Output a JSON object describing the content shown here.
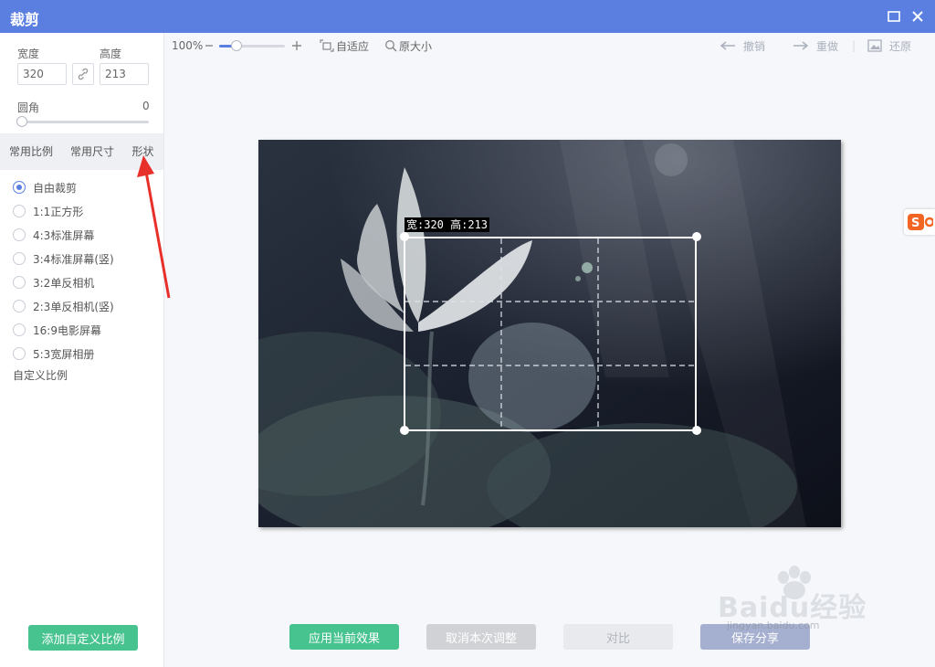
{
  "window": {
    "title": "裁剪"
  },
  "sidebar": {
    "width_label": "宽度",
    "height_label": "高度",
    "width_value": "320",
    "height_value": "213",
    "radius_label": "圆角",
    "radius_value": "0",
    "tabs": [
      {
        "label": "常用比例",
        "active": false
      },
      {
        "label": "常用尺寸",
        "active": false
      },
      {
        "label": "形状",
        "active": true
      }
    ],
    "ratios": [
      {
        "label": "自由裁剪",
        "checked": true
      },
      {
        "label": "1:1正方形",
        "checked": false
      },
      {
        "label": "4:3标准屏幕",
        "checked": false
      },
      {
        "label": "3:4标准屏幕(竖)",
        "checked": false
      },
      {
        "label": "3:2单反相机",
        "checked": false
      },
      {
        "label": "2:3单反相机(竖)",
        "checked": false
      },
      {
        "label": "16:9电影屏幕",
        "checked": false
      },
      {
        "label": "5:3宽屏相册",
        "checked": false
      }
    ],
    "custom_ratio_label": "自定义比例",
    "add_custom_button": "添加自定义比例"
  },
  "toolbar": {
    "zoom_percent": "100%",
    "zoom_level": 0.27,
    "fit_label": "自适应",
    "original_size_label": "原大小",
    "undo_label": "撤销",
    "redo_label": "重做",
    "restore_label": "还原"
  },
  "canvas": {
    "crop_label": "宽:320 高:213"
  },
  "buttons": {
    "apply": "应用当前效果",
    "cancel": "取消本次调整",
    "compare": "对比",
    "save_share": "保存分享"
  },
  "watermark": {
    "brand": "Baidu经验",
    "url": "jingyan.baidu.com"
  },
  "colors": {
    "accent": "#5b7fe0",
    "primary_button": "#47c38f",
    "annotation_arrow": "#e8302a"
  }
}
